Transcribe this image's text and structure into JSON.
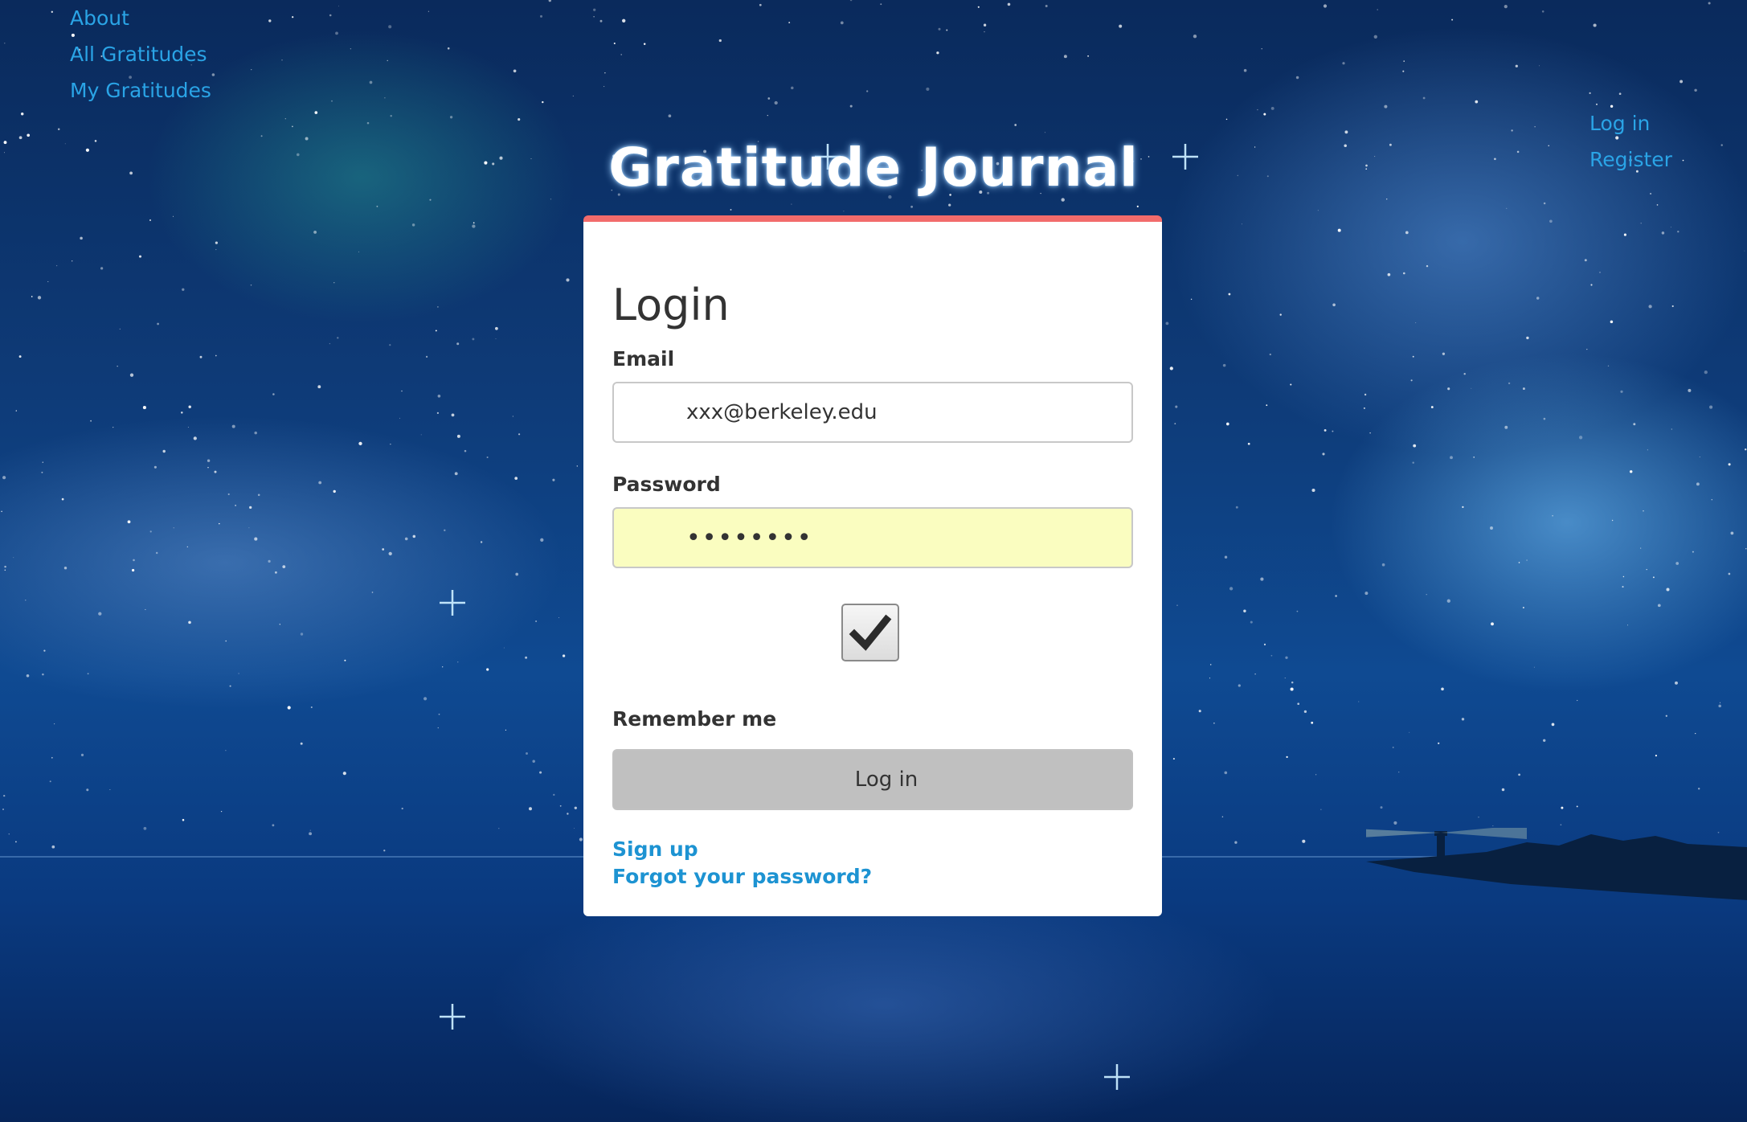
{
  "nav": {
    "left": [
      {
        "label": "About"
      },
      {
        "label": "All Gratitudes"
      },
      {
        "label": "My Gratitudes"
      }
    ],
    "right": [
      {
        "label": "Log in"
      },
      {
        "label": "Register"
      }
    ]
  },
  "site": {
    "title": "Gratitude Journal"
  },
  "login": {
    "heading": "Login",
    "email_label": "Email",
    "email_value": "xxx@berkeley.edu",
    "password_label": "Password",
    "password_value": "••••••••",
    "remember_checked": true,
    "remember_label": "Remember me",
    "submit_label": "Log in",
    "signup_link": "Sign up",
    "forgot_link": "Forgot your password?"
  },
  "colors": {
    "accent_top_border": "#f26b6b",
    "link": "#1d93d2",
    "nav_link": "#2aa4e6",
    "autofill_bg": "#fafdc0",
    "button_bg": "#c0c0c0"
  },
  "icons": {
    "checkbox": "checkmark-icon"
  }
}
